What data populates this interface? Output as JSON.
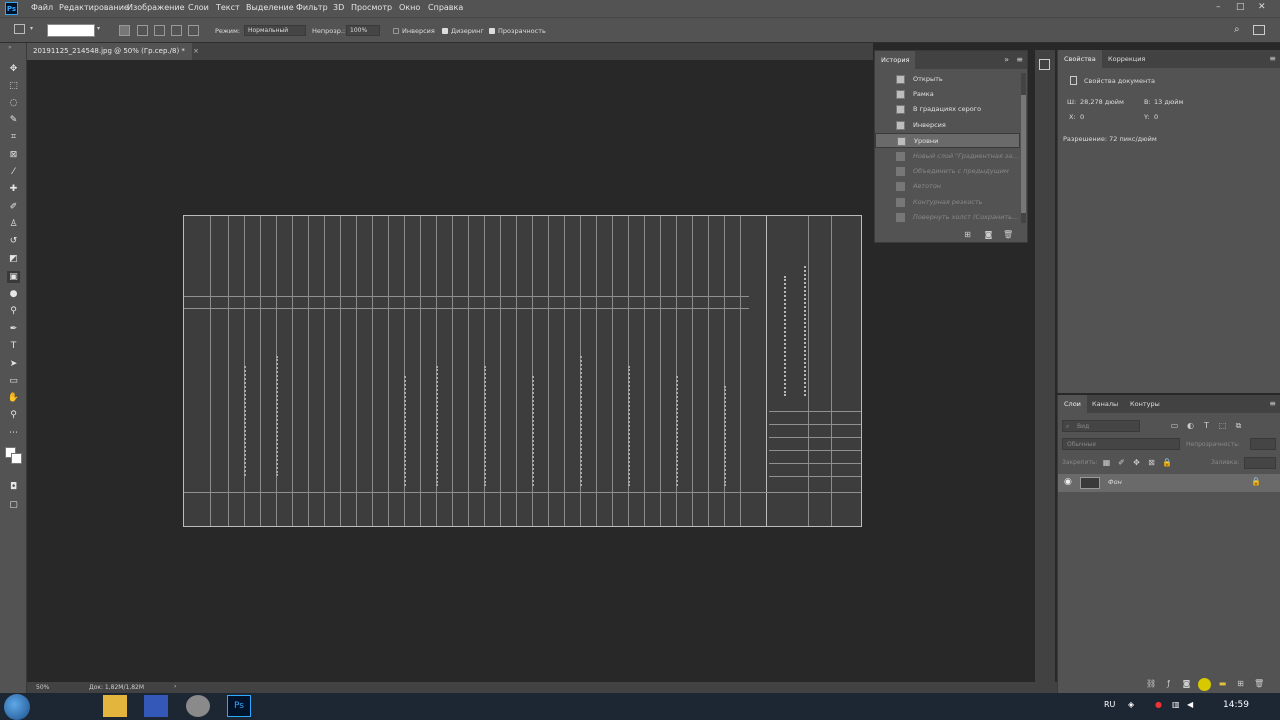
{
  "menubar": {
    "app_icon": "Ps",
    "items": [
      "Файл",
      "Редактирование",
      "Изображение",
      "Слои",
      "Текст",
      "Выделение",
      "Фильтр",
      "3D",
      "Просмотр",
      "Окно",
      "Справка"
    ]
  },
  "options": {
    "mode_label": "Режим:",
    "mode_value": "Нормальный",
    "opacity_label": "Непрозр.:",
    "opacity_value": "100%",
    "inverse_label": "Инверсия",
    "inverse_checked": false,
    "dither_label": "Дизеринг",
    "dither_checked": true,
    "transparency_label": "Прозрачность",
    "transparency_checked": true
  },
  "document": {
    "tab_title": "20191125_214548.jpg @ 50% (Гр.сер./8) *",
    "close_symbol": "×"
  },
  "status": {
    "zoom": "50%",
    "doc_size": "Док: 1,82M/1,82M",
    "arrow": "›"
  },
  "history_panel": {
    "tab_label": "История",
    "collapse_symbol": "»",
    "menu_symbol": "≡",
    "items": [
      {
        "label": "Открыть",
        "state": "normal"
      },
      {
        "label": "Рамка",
        "state": "normal"
      },
      {
        "label": "В градациях серого",
        "state": "normal"
      },
      {
        "label": "Инверсия",
        "state": "normal"
      },
      {
        "label": "Уровни",
        "state": "selected"
      },
      {
        "label": "Новый слой \"Градиентная за...",
        "state": "dimmed"
      },
      {
        "label": "Объединить с предыдущим",
        "state": "dimmed"
      },
      {
        "label": "Автотон",
        "state": "dimmed"
      },
      {
        "label": "Контурная резкость",
        "state": "dimmed"
      },
      {
        "label": "Повернуть холст (Сохранить...",
        "state": "dimmed"
      }
    ]
  },
  "properties_panel": {
    "tabs": [
      "Свойства",
      "Коррекция"
    ],
    "section_title": "Свойства документа",
    "width_label": "Ш:",
    "width_value": "28,278 дюйм",
    "height_label": "В:",
    "height_value": "13 дюйм",
    "x_label": "X:",
    "x_value": "0",
    "y_label": "Y:",
    "y_value": "0",
    "resolution": "Разрешение: 72 пикс/дюйм"
  },
  "layers_panel": {
    "tabs": [
      "Слои",
      "Каналы",
      "Контуры"
    ],
    "search_placeholder": "Вид",
    "blend_mode": "Обычные",
    "opacity_label": "Непрозрачность:",
    "lock_label": "Закрепить:",
    "fill_label": "Заливка:",
    "layers": [
      {
        "name": "Фон",
        "visible": true,
        "locked": true
      }
    ]
  },
  "taskbar": {
    "lang": "RU",
    "time": "14:59"
  },
  "colors": {
    "ui_bg": "#535353",
    "canvas_bg": "#282828",
    "ps_blue": "#31a8ff",
    "taskbar": "#1d2633"
  }
}
